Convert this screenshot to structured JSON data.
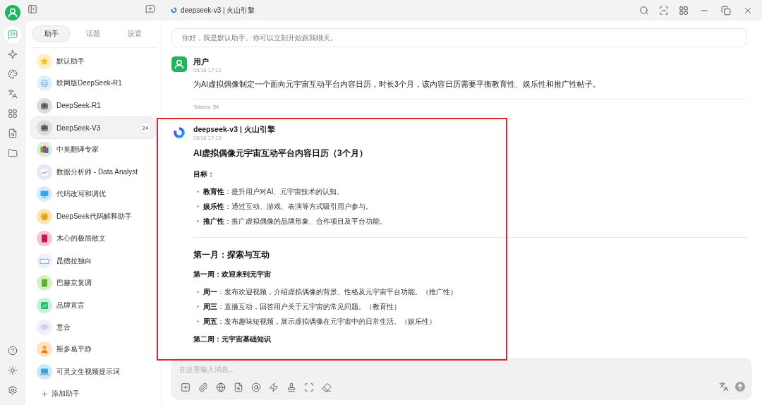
{
  "window": {
    "title": "deepseek-v3 | 火山引擎"
  },
  "nav_rail": {
    "items": [
      {
        "selected": true
      },
      {
        "selected": false
      },
      {
        "selected": false
      },
      {
        "selected": false
      },
      {
        "selected": false
      },
      {
        "selected": false
      },
      {
        "selected": false
      }
    ]
  },
  "sidebar": {
    "tabs": [
      {
        "label": "助手",
        "selected": true
      },
      {
        "label": "话题",
        "selected": false
      },
      {
        "label": "设置",
        "selected": false
      }
    ],
    "assistants": [
      {
        "name": "默认助手",
        "selected": false
      },
      {
        "name": "联网版DeepSeek-R1",
        "selected": false
      },
      {
        "name": "DeepSeek-R1",
        "selected": false
      },
      {
        "name": "DeepSeek-V3",
        "selected": true,
        "badge": "24"
      },
      {
        "name": "中英翻译专家",
        "selected": false
      },
      {
        "name": "数据分析师 - Data Analyst",
        "selected": false
      },
      {
        "name": "代码改写和调优",
        "selected": false
      },
      {
        "name": "DeepSeek代码解释助手",
        "selected": false
      },
      {
        "name": "木心的极简散文",
        "selected": false
      },
      {
        "name": "昆德拉独白",
        "selected": false
      },
      {
        "name": "巴赫京复调",
        "selected": false
      },
      {
        "name": "品牌宣言",
        "selected": false
      },
      {
        "name": "意合",
        "selected": false
      },
      {
        "name": "斯多葛平静",
        "selected": false
      },
      {
        "name": "可灵文生视频提示词",
        "selected": false
      }
    ],
    "add_label": "添加助手"
  },
  "chat": {
    "welcome": "你好，我是默认助手。你可以立刻开始跟我聊天。",
    "messages": [
      {
        "kind": "user",
        "author": "用户",
        "time": "05/16 17:13",
        "text": "为AI虚拟偶像制定一个面向元宇宙互动平台内容日历，时长3个月，该内容日历需要平衡教育性、娱乐性和推广性帖子。",
        "tokens": "Tokens: 54",
        "highlighted": false
      },
      {
        "kind": "assistant",
        "author": "deepseek-v3 | 火山引擎",
        "time": "05/16 17:13",
        "highlighted": true,
        "blocks": [
          {
            "kind": "title",
            "text": "AI虚拟偶像元宇宙互动平台内容日历（3个月）"
          },
          {
            "kind": "subheading",
            "text": "目标："
          },
          {
            "kind": "bullet",
            "text": "**教育性**：提升用户对AI、元宇宙技术的认知。"
          },
          {
            "kind": "bullet",
            "text": "**娱乐性**：通过互动、游戏、表演等方式吸引用户参与。"
          },
          {
            "kind": "bullet",
            "text": "**推广性**：推广虚拟偶像的品牌形象、合作项目及平台功能。"
          },
          {
            "kind": "rule"
          },
          {
            "kind": "heading",
            "text": "第一月：探索与互动"
          },
          {
            "kind": "subheading",
            "text": "第一周：欢迎来到元宇宙"
          },
          {
            "kind": "bullet",
            "text": "**周一**：发布欢迎视频，介绍虚拟偶像的背景、性格及元宇宙平台功能。（推广性）"
          },
          {
            "kind": "bullet",
            "text": "**周三**：直播互动，回答用户关于元宇宙的常见问题。（教育性）"
          },
          {
            "kind": "bullet",
            "text": "**周五**：发布趣味短视频，展示虚拟偶像在元宇宙中的日常生活。（娱乐性）"
          },
          {
            "kind": "subheading",
            "text": "第二周：元宇宙基础知识"
          }
        ]
      }
    ]
  },
  "composer": {
    "placeholder": "在这里输入消息..."
  }
}
